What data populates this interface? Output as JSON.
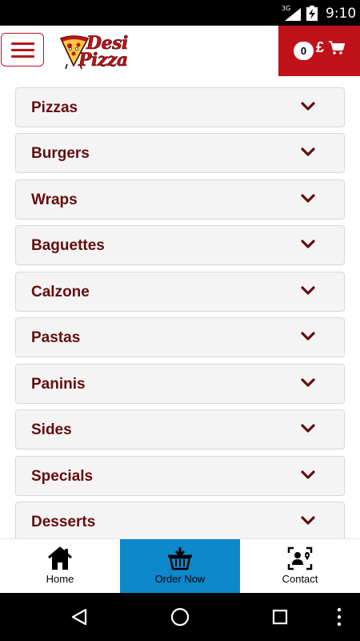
{
  "status_bar": {
    "network": "3G",
    "time": "9:10"
  },
  "header": {
    "logo_line1": "Desi",
    "logo_line2": "Pizza",
    "cart_count": "0",
    "cart_currency": "£"
  },
  "menu": {
    "categories": [
      {
        "label": "Pizzas"
      },
      {
        "label": "Burgers"
      },
      {
        "label": "Wraps"
      },
      {
        "label": "Baguettes"
      },
      {
        "label": "Calzone"
      },
      {
        "label": "Pastas"
      },
      {
        "label": "Paninis"
      },
      {
        "label": "Sides"
      },
      {
        "label": "Specials"
      },
      {
        "label": "Desserts"
      }
    ]
  },
  "bottom_nav": {
    "home": "Home",
    "order_now": "Order Now",
    "contact": "Contact"
  },
  "colors": {
    "brand_red": "#c1121a",
    "category_text": "#650d0d",
    "order_active": "#0c88cb"
  },
  "icons": {
    "menu": "hamburger-icon",
    "cart": "shopping-cart-icon",
    "chevron": "chevron-down-icon",
    "home": "home-icon",
    "order": "basket-icon",
    "contact": "contact-card-icon"
  }
}
